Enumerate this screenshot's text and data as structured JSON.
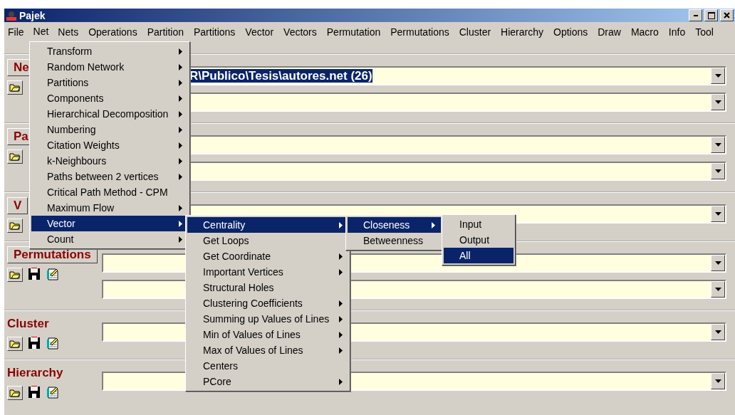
{
  "window": {
    "title": "Pajek"
  },
  "menubar": [
    {
      "label": "File",
      "selected": false
    },
    {
      "label": "Net",
      "selected": true
    },
    {
      "label": "Nets",
      "selected": false
    },
    {
      "label": "Operations",
      "selected": false
    },
    {
      "label": "Partition",
      "selected": false
    },
    {
      "label": "Partitions",
      "selected": false
    },
    {
      "label": "Vector",
      "selected": false
    },
    {
      "label": "Vectors",
      "selected": false
    },
    {
      "label": "Permutation",
      "selected": false
    },
    {
      "label": "Permutations",
      "selected": false
    },
    {
      "label": "Cluster",
      "selected": false
    },
    {
      "label": "Hierarchy",
      "selected": false
    },
    {
      "label": "Options",
      "selected": false
    },
    {
      "label": "Draw",
      "selected": false
    },
    {
      "label": "Macro",
      "selected": false
    },
    {
      "label": "Info",
      "selected": false
    },
    {
      "label": "Tool",
      "selected": false
    }
  ],
  "sections": [
    {
      "label": "Ne",
      "kind": "tab",
      "tools": [
        {
          "kind": "open"
        }
      ],
      "fields": [
        {
          "kind": "combo",
          "value": "R\\Publico\\Tesis\\autores.net (26)",
          "selected": true
        },
        {
          "kind": "combo"
        }
      ]
    },
    {
      "label": "Pa",
      "kind": "tab",
      "tools": [
        {
          "kind": "open"
        }
      ],
      "fields": [
        {
          "kind": "combo"
        },
        {
          "kind": "combo"
        }
      ]
    },
    {
      "label": "V",
      "kind": "tab",
      "tools": [
        {
          "kind": "open"
        }
      ],
      "fields": [
        {
          "kind": "combo"
        }
      ]
    },
    {
      "label": "Permutations",
      "kind": "tab",
      "tools": [
        {
          "kind": "open"
        },
        {
          "kind": "save"
        },
        {
          "kind": "edit"
        }
      ],
      "fields": [
        {
          "kind": "combo"
        },
        {
          "kind": "combo"
        }
      ]
    },
    {
      "label": "Cluster",
      "kind": "plain",
      "tools": [
        {
          "kind": "open"
        },
        {
          "kind": "save"
        },
        {
          "kind": "edit"
        }
      ],
      "fields": [
        {
          "kind": "combo"
        }
      ]
    },
    {
      "label": "Hierarchy",
      "kind": "plain",
      "tools": [
        {
          "kind": "open"
        },
        {
          "kind": "save"
        },
        {
          "kind": "edit"
        }
      ],
      "fields": [
        {
          "kind": "combo"
        }
      ]
    }
  ],
  "menus": [
    {
      "items": [
        {
          "label": "Transform",
          "submenu": true,
          "selected": false
        },
        {
          "label": "Random Network",
          "submenu": true,
          "selected": false
        },
        {
          "label": "Partitions",
          "submenu": true,
          "selected": false
        },
        {
          "label": "Components",
          "submenu": true,
          "selected": false
        },
        {
          "label": "Hierarchical Decomposition",
          "submenu": true,
          "selected": false
        },
        {
          "label": "Numbering",
          "submenu": true,
          "selected": false
        },
        {
          "label": "Citation Weights",
          "submenu": true,
          "selected": false
        },
        {
          "label": "k-Neighbours",
          "submenu": true,
          "selected": false
        },
        {
          "label": "Paths between 2 vertices",
          "submenu": true,
          "selected": false
        },
        {
          "label": "Critical Path Method - CPM",
          "submenu": false,
          "selected": false
        },
        {
          "label": "Maximum Flow",
          "submenu": true,
          "selected": false
        },
        {
          "label": "Vector",
          "submenu": true,
          "selected": true
        },
        {
          "label": "Count",
          "submenu": true,
          "selected": false
        }
      ]
    },
    {
      "items": [
        {
          "label": "Centrality",
          "submenu": true,
          "selected": true
        },
        {
          "label": "Get Loops",
          "submenu": false,
          "selected": false
        },
        {
          "label": "Get Coordinate",
          "submenu": true,
          "selected": false
        },
        {
          "label": "Important Vertices",
          "submenu": true,
          "selected": false
        },
        {
          "label": "Structural Holes",
          "submenu": false,
          "selected": false
        },
        {
          "label": "Clustering Coefficients",
          "submenu": true,
          "selected": false
        },
        {
          "label": "Summing up Values of Lines",
          "submenu": true,
          "selected": false
        },
        {
          "label": "Min of Values of Lines",
          "submenu": true,
          "selected": false
        },
        {
          "label": "Max of Values of Lines",
          "submenu": true,
          "selected": false
        },
        {
          "label": "Centers",
          "submenu": false,
          "selected": false
        },
        {
          "label": "PCore",
          "submenu": true,
          "selected": false
        }
      ]
    },
    {
      "items": [
        {
          "label": "Closeness",
          "submenu": true,
          "selected": true
        },
        {
          "label": "Betweenness",
          "submenu": false,
          "selected": false
        }
      ]
    },
    {
      "items": [
        {
          "label": "Input",
          "submenu": false,
          "selected": false
        },
        {
          "label": "Output",
          "submenu": false,
          "selected": false
        },
        {
          "label": "All",
          "submenu": false,
          "selected": true
        }
      ]
    }
  ]
}
